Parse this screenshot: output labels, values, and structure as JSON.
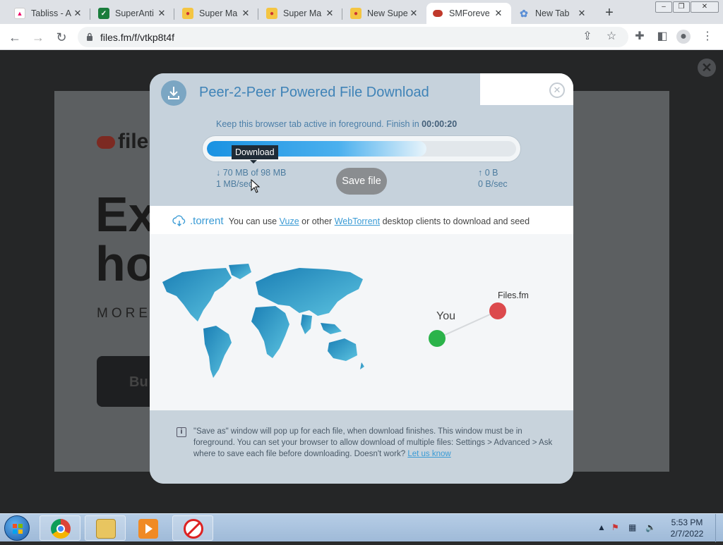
{
  "browser": {
    "tabs": [
      {
        "title": "Tabliss - A",
        "active": false
      },
      {
        "title": "SuperAnti",
        "active": false
      },
      {
        "title": "Super Ma",
        "active": false
      },
      {
        "title": "Super Ma",
        "active": false
      },
      {
        "title": "New Supe",
        "active": false
      },
      {
        "title": "SMForeve",
        "active": true
      },
      {
        "title": "New Tab",
        "active": false
      }
    ],
    "new_tab_label": "+",
    "url": "files.fm/f/vtkp8t4f"
  },
  "background": {
    "logo_text": "file",
    "headline": "Ex\nho",
    "subtitle": "MORE",
    "button_text": "Bu"
  },
  "modal": {
    "title": "Peer-2-Peer Powered File Download",
    "keep_text": "Keep this browser tab active in foreground. Finish in",
    "finish_time": "00:00:20",
    "progress_percent": 71,
    "tooltip": "Download",
    "download_amount": "↓ 70 MB of 98 MB",
    "download_speed": "1 MB/sec",
    "upload_amount": "↑ 0 B",
    "upload_speed": "0 B/sec",
    "save_button": "Save file",
    "torrent_label": ".torrent",
    "torrent_text_1": "You can use",
    "vuze_link": "Vuze",
    "torrent_text_2": "or other",
    "webtorrent_link": "WebTorrent",
    "torrent_text_3": "desktop clients to download and seed",
    "peer_you": "You",
    "peer_files": "Files.fm",
    "note_text": "\"Save as\" window will pop up for each file, when download finishes. This window must be in foreground. You can set your browser to allow download of multiple files: Settings > Advanced > Ask where to save each file before downloading. Doesn't work?",
    "note_link": "Let us know"
  },
  "taskbar": {
    "time": "5:53 PM",
    "date": "2/7/2022"
  }
}
